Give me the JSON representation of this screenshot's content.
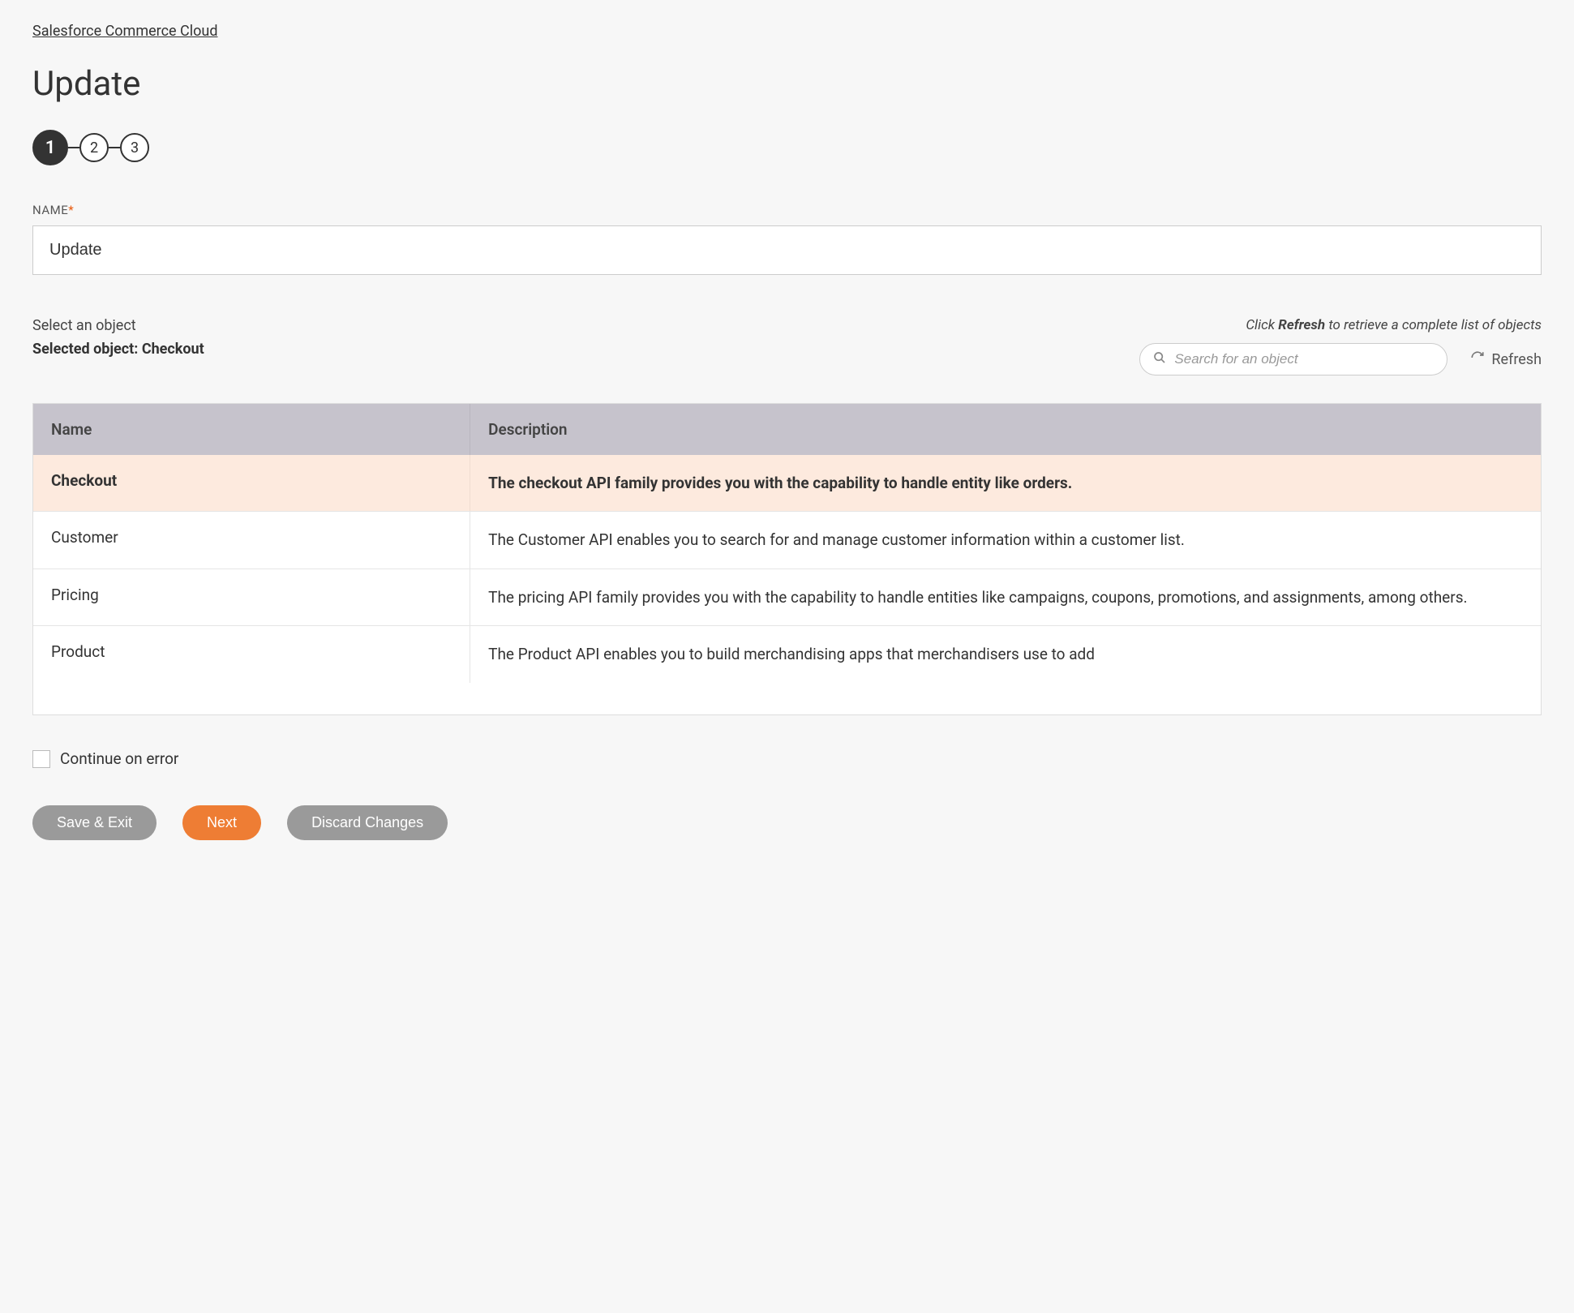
{
  "breadcrumb": {
    "link": "Salesforce Commerce Cloud"
  },
  "page": {
    "title": "Update"
  },
  "stepper": {
    "steps": [
      "1",
      "2",
      "3"
    ],
    "active": 0
  },
  "name_field": {
    "label": "NAME",
    "required_mark": "*",
    "value": "Update"
  },
  "object_section": {
    "select_label": "Select an object",
    "selected_prefix": "Selected object:",
    "selected_value": "Checkout",
    "hint_prefix": "Click",
    "hint_bold": "Refresh",
    "hint_suffix": "to retrieve a complete list of objects",
    "search_placeholder": "Search for an object",
    "refresh_label": "Refresh"
  },
  "table": {
    "headers": {
      "name": "Name",
      "description": "Description"
    },
    "rows": [
      {
        "name": "Checkout",
        "description": "The checkout API family provides you with the capability to handle entity like orders.",
        "selected": true
      },
      {
        "name": "Customer",
        "description": "The Customer API enables you to search for and manage customer information within a customer list.",
        "selected": false
      },
      {
        "name": "Pricing",
        "description": "The pricing API family provides you with the capability to handle entities like campaigns, coupons, promotions, and assignments, among others.",
        "selected": false
      },
      {
        "name": "Product",
        "description": "The Product API enables you to build merchandising apps that merchandisers use to add",
        "selected": false
      }
    ]
  },
  "continue_on_error": {
    "label": "Continue on error",
    "checked": false
  },
  "footer": {
    "save_exit": "Save & Exit",
    "next": "Next",
    "discard": "Discard Changes"
  }
}
